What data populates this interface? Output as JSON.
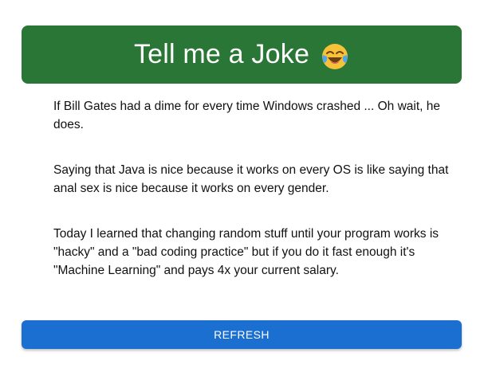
{
  "header": {
    "title": "Tell me a Joke",
    "emoji": "face-with-tears-of-joy-icon",
    "background_color": "#2a7636"
  },
  "jokes": [
    "If Bill Gates had a dime for every time Windows crashed ... Oh wait, he does.",
    "Saying that Java is nice because it works on every OS is like saying that anal sex is nice because it works on every gender.",
    "Today I learned that changing random stuff until your program works is \"hacky\" and a \"bad coding practice\" but if you do it fast enough it's \"Machine Learning\" and pays 4x your current salary."
  ],
  "refresh_button": {
    "label": "REFRESH",
    "background_color": "#1b6fd0"
  }
}
